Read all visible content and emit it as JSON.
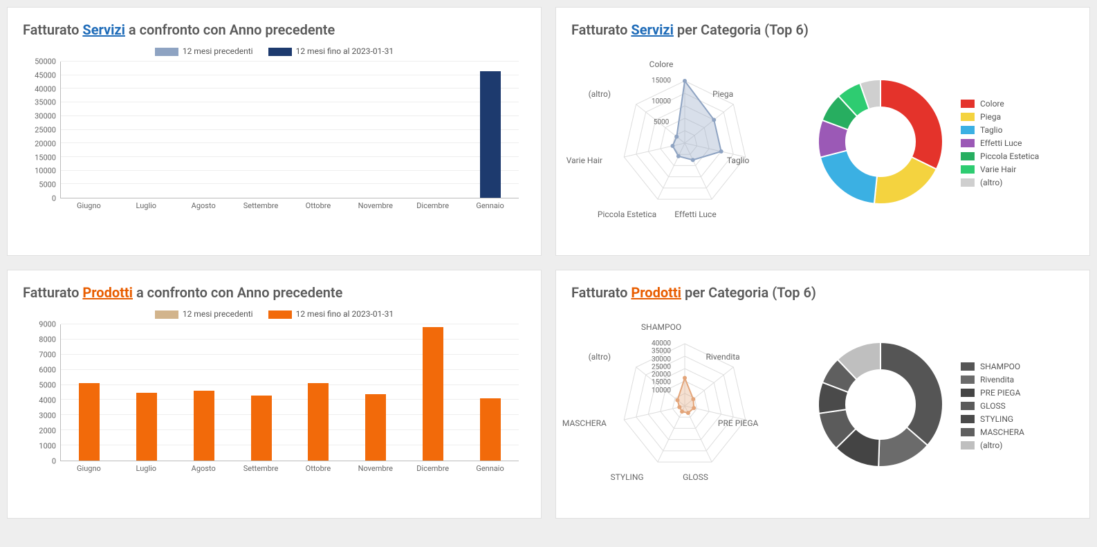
{
  "titles": {
    "t1_pre": "Fatturato ",
    "t1_link": "Servizi",
    "t1_post": " a confronto con Anno precedente",
    "t2_pre": "Fatturato ",
    "t2_link": "Servizi",
    "t2_post": " per Categoria (Top 6)",
    "t3_pre": "Fatturato ",
    "t3_link": "Prodotti",
    "t3_post": " a confronto con Anno precedente",
    "t4_pre": "Fatturato ",
    "t4_link": "Prodotti",
    "t4_post": " per Categoria (Top 6)"
  },
  "bar_legend": {
    "prev": "12 mesi precedenti",
    "cur": "12 mesi fino al 2023-01-31"
  },
  "colors": {
    "bar_prev_servizi": "#8ea3c2",
    "bar_cur_servizi": "#1d3a6e",
    "bar_prev_prodotti": "#d2b48c",
    "bar_cur_prodotti": "#f26a0a",
    "donut1": [
      "#e4332b",
      "#f4d33f",
      "#3bb0e3",
      "#9b59b6",
      "#27ae60",
      "#2ecc71",
      "#cfcfcf"
    ],
    "donut2": [
      "#555555",
      "#6b6b6b",
      "#444444",
      "#5b5b5b",
      "#4a4a4a",
      "#5f5f5f",
      "#bfbfbf"
    ]
  },
  "chart_data": [
    {
      "id": "servizi_bar",
      "type": "bar",
      "categories": [
        "Giugno",
        "Luglio",
        "Agosto",
        "Settembre",
        "Ottobre",
        "Novembre",
        "Dicembre",
        "Gennaio"
      ],
      "series": [
        {
          "name": "12 mesi precedenti",
          "values": [
            0,
            0,
            0,
            0,
            0,
            0,
            0,
            0
          ]
        },
        {
          "name": "12 mesi fino al 2023-01-31",
          "values": [
            0,
            0,
            0,
            0,
            0,
            0,
            0,
            46500
          ]
        }
      ],
      "ylim": [
        0,
        50000
      ],
      "ystep": 5000
    },
    {
      "id": "servizi_cat",
      "type": "radar+donut",
      "categories": [
        "Colore",
        "Piega",
        "Taglio",
        "Effetti Luce",
        "Piccola Estetica",
        "Varie Hair",
        "(altro)"
      ],
      "values": [
        15000,
        9000,
        9000,
        4500,
        3500,
        3000,
        2500
      ],
      "radar_ticks": [
        5000,
        10000,
        15000
      ],
      "radar_max": 15000
    },
    {
      "id": "prodotti_bar",
      "type": "bar",
      "categories": [
        "Giugno",
        "Luglio",
        "Agosto",
        "Settembre",
        "Ottobre",
        "Novembre",
        "Dicembre",
        "Gennaio"
      ],
      "series": [
        {
          "name": "12 mesi precedenti",
          "values": [
            0,
            0,
            0,
            0,
            0,
            0,
            0,
            0
          ]
        },
        {
          "name": "12 mesi fino al 2023-01-31",
          "values": [
            5100,
            4500,
            4600,
            4300,
            5100,
            4400,
            8800,
            4100
          ]
        }
      ],
      "ylim": [
        0,
        9000
      ],
      "ystep": 1000
    },
    {
      "id": "prodotti_cat",
      "type": "radar+donut",
      "categories": [
        "SHAMPOO",
        "Rivendita",
        "PRE PIEGA",
        "GLOSS",
        "STYLING",
        "MASCHERA",
        "(altro)"
      ],
      "values": [
        18000,
        7000,
        6000,
        5000,
        4000,
        3500,
        6000
      ],
      "radar_ticks": [
        10000,
        15000,
        20000,
        25000,
        30000,
        35000,
        40000
      ],
      "radar_max": 40000
    }
  ]
}
